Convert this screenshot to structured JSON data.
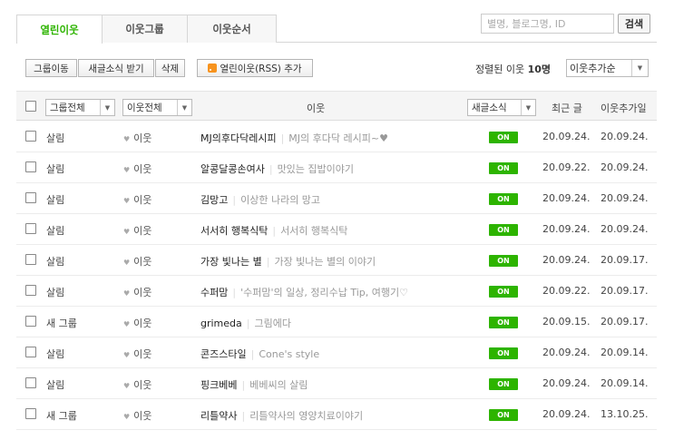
{
  "tabs": [
    {
      "label": "열린이웃"
    },
    {
      "label": "이웃그룹"
    },
    {
      "label": "이웃순서"
    }
  ],
  "search": {
    "placeholder": "별명, 블로그명, ID",
    "button": "검색"
  },
  "toolbar": {
    "move": "그룹이동",
    "receive": "새글소식 받기",
    "delete": "삭제",
    "rss": "열린이웃(RSS) 추가",
    "sort_prefix": "정렬된 이웃",
    "sort_count": "10명",
    "sort_value": "이웃추가순"
  },
  "header": {
    "group_select": "그룹전체",
    "relation_select": "이웃전체",
    "neighbor": "이웃",
    "news_select": "새글소식",
    "recent": "최근 글",
    "added": "이웃추가일"
  },
  "rows": [
    {
      "group": "살림",
      "relation": "이웃",
      "name": "MJ의후다닥레시피",
      "desc": "MJ의 후다닥 레시피~♥",
      "news": "ON",
      "recent": "20.09.24.",
      "added": "20.09.24."
    },
    {
      "group": "살림",
      "relation": "이웃",
      "name": "알콩달콩손여사",
      "desc": "맛있는 집밥이야기",
      "news": "ON",
      "recent": "20.09.22.",
      "added": "20.09.24."
    },
    {
      "group": "살림",
      "relation": "이웃",
      "name": "김망고",
      "desc": "이상한 나라의 망고",
      "news": "ON",
      "recent": "20.09.24.",
      "added": "20.09.24."
    },
    {
      "group": "살림",
      "relation": "이웃",
      "name": "서서히 행복식탁",
      "desc": "서서히 행복식탁",
      "news": "ON",
      "recent": "20.09.24.",
      "added": "20.09.24."
    },
    {
      "group": "살림",
      "relation": "이웃",
      "name": "가장 빛나는 별",
      "desc": "가장 빛나는 별의 이야기",
      "news": "ON",
      "recent": "20.09.24.",
      "added": "20.09.17."
    },
    {
      "group": "살림",
      "relation": "이웃",
      "name": "수퍼맘",
      "desc": "'수퍼맘'의 일상, 정리수납 Tip, 여행기♡",
      "news": "ON",
      "recent": "20.09.22.",
      "added": "20.09.17."
    },
    {
      "group": "새 그룹",
      "relation": "이웃",
      "name": "grimeda",
      "desc": "그림에다",
      "news": "ON",
      "recent": "20.09.15.",
      "added": "20.09.17."
    },
    {
      "group": "살림",
      "relation": "이웃",
      "name": "콘즈스타일",
      "desc": "Cone's style",
      "news": "ON",
      "recent": "20.09.24.",
      "added": "20.09.14."
    },
    {
      "group": "살림",
      "relation": "이웃",
      "name": "핑크베베",
      "desc": "베베씨의 살림",
      "news": "ON",
      "recent": "20.09.24.",
      "added": "20.09.14."
    },
    {
      "group": "새 그룹",
      "relation": "이웃",
      "name": "리틀약사",
      "desc": "리틀약사의 영양치료이야기",
      "news": "ON",
      "recent": "20.09.24.",
      "added": "13.10.25."
    }
  ],
  "colors": {
    "accent": "#2db400",
    "rss": "#f7931e"
  },
  "icons": {
    "heart": "heart-icon",
    "dropdown": "chevron-down-icon",
    "rss": "rss-icon"
  }
}
